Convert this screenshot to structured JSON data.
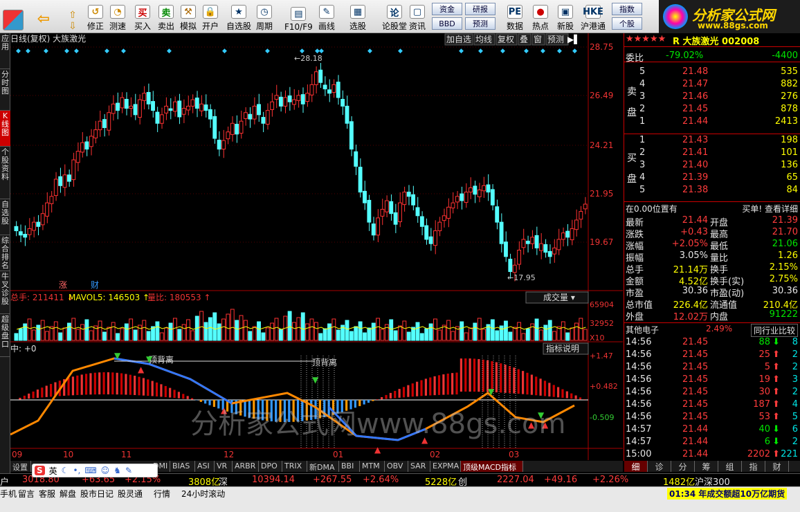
{
  "toolbar": {
    "items": [
      {
        "label": "买入",
        "icon": "买",
        "color": "#c00"
      },
      {
        "label": "卖出",
        "icon": "卖",
        "color": "#080"
      },
      {
        "label": "模拟",
        "icon": "⚒",
        "color": "#a60"
      },
      {
        "label": "开户",
        "icon": "🔒",
        "color": "#333"
      },
      {
        "label": "自选股",
        "icon": "★",
        "color": "#036"
      },
      {
        "label": "周期",
        "icon": "◷",
        "color": "#036"
      },
      {
        "label": "F10/F9",
        "icon": "▤",
        "color": "#036"
      },
      {
        "label": "画线",
        "icon": "✎",
        "color": "#036"
      },
      {
        "label": "选股",
        "icon": "▦",
        "color": "#036"
      },
      {
        "label": "论股堂",
        "icon": "论",
        "color": "#036"
      },
      {
        "label": "资讯",
        "icon": "▢",
        "color": "#036"
      },
      {
        "label": "数据",
        "icon": "PE",
        "color": "#036"
      },
      {
        "label": "热点",
        "icon": "●",
        "color": "#c00"
      },
      {
        "label": "新股",
        "icon": "▣",
        "color": "#036"
      },
      {
        "label": "沪港通",
        "icon": "HKE",
        "color": "#036"
      }
    ],
    "nav": [
      {
        "label": "修正",
        "icon": "↺"
      },
      {
        "label": "测速",
        "icon": "◔"
      }
    ],
    "buttons": [
      "资金",
      "BBD",
      "研报",
      "预测",
      "指数",
      "个股"
    ],
    "logo_text": "分析家公式网",
    "logo_url": "www.88gs.com"
  },
  "leftbar": [
    "应用",
    "分时图",
    "K线图",
    "个股资料",
    "自选股",
    "综合排名",
    "牛叉诊股",
    "超级盘口"
  ],
  "chart": {
    "title": "日线(复权)  大族激光",
    "toolbar": [
      "加自选",
      "均线",
      "复权",
      "叠",
      "窗",
      "预测"
    ],
    "price_ticks": [
      "28.75",
      "26.49",
      "24.21",
      "21.95",
      "19.67"
    ],
    "high_label": "28.18",
    "low_label": "17.95",
    "markers": [
      "涨",
      "财"
    ],
    "vol_legend": {
      "total": "总手: 211411",
      "mavol": "MAVOL5: 146503",
      "ratio": "量比: 180553",
      "dropdown": "成交量"
    },
    "vol_ticks": [
      "65904",
      "32952",
      "X10"
    ],
    "macd_legend": "中: +0",
    "macd_btn": "指标说明",
    "macd_ticks": [
      "+1.47",
      "+0.482",
      "-0.509"
    ],
    "macd_labels": [
      "顶背离",
      "顶背离"
    ],
    "x_labels": [
      "09",
      "10",
      "11",
      "12",
      "01",
      "02",
      "03"
    ],
    "watermark": "分析家公式网www.88gs.com"
  },
  "bottom_tabs": [
    "设置",
    "DMI",
    "BIAS",
    "ASI",
    "VR",
    "ARBR",
    "DPO",
    "TRIX",
    "新DMA",
    "BBI",
    "MTM",
    "OBV",
    "SAR",
    "EXPMA",
    "顶级MACD指标"
  ],
  "right": {
    "stock": "R 大族激光 002008",
    "weibi": {
      "label": "委比",
      "pct": "-79.02%",
      "diff": "-4400"
    },
    "sell": [
      {
        "n": "5",
        "p": "21.48",
        "v": "535"
      },
      {
        "n": "4",
        "p": "21.47",
        "v": "882"
      },
      {
        "n": "3",
        "p": "21.46",
        "v": "276"
      },
      {
        "n": "2",
        "p": "21.45",
        "v": "878"
      },
      {
        "n": "1",
        "p": "21.44",
        "v": "2413"
      }
    ],
    "buy": [
      {
        "n": "1",
        "p": "21.43",
        "v": "198"
      },
      {
        "n": "2",
        "p": "21.41",
        "v": "101"
      },
      {
        "n": "3",
        "p": "21.40",
        "v": "136"
      },
      {
        "n": "4",
        "p": "21.39",
        "v": "65"
      },
      {
        "n": "5",
        "p": "21.38",
        "v": "84"
      }
    ],
    "sell_label": "卖盘",
    "buy_label": "买盘",
    "pos": "在0.00位置有",
    "pos_right": "买单! 查看详细",
    "quotes": [
      [
        "最新",
        "21.44",
        "开盘",
        "21.39"
      ],
      [
        "涨跌",
        "+0.43",
        "最高",
        "21.70"
      ],
      [
        "涨幅",
        "+2.05%",
        "最低",
        "21.06"
      ],
      [
        "振幅",
        "3.05%",
        "量比",
        "1.26"
      ],
      [
        "总手",
        "21.14万",
        "换手",
        "2.15%"
      ],
      [
        "金额",
        "4.52亿",
        "换手(实)",
        "2.75%"
      ],
      [
        "市盈",
        "30.36",
        "市盈(动)",
        "30.36"
      ],
      [
        "总市值",
        "226.4亿",
        "流通值",
        "210.4亿"
      ],
      [
        "外盘",
        "12.02万",
        "内盘",
        "91222"
      ]
    ],
    "sector": "其他电子",
    "sector_pct": "2.49%",
    "sector_btn": "同行业比较",
    "ticks": [
      [
        "14:56",
        "21.45",
        "88",
        "8"
      ],
      [
        "14:56",
        "21.45",
        "25",
        "2"
      ],
      [
        "14:56",
        "21.45",
        "5",
        "2"
      ],
      [
        "14:56",
        "21.45",
        "19",
        "3"
      ],
      [
        "14:56",
        "21.45",
        "30",
        "2"
      ],
      [
        "14:56",
        "21.45",
        "187",
        "4"
      ],
      [
        "14:56",
        "21.45",
        "53",
        "5"
      ],
      [
        "14:57",
        "21.44",
        "40",
        "6"
      ],
      [
        "14:57",
        "21.44",
        "6",
        "2"
      ],
      [
        "15:00",
        "21.44",
        "2202",
        "221"
      ]
    ],
    "tabs": [
      "细",
      "诊",
      "分",
      "筹",
      "组",
      "指",
      "财"
    ]
  },
  "status": {
    "a": "3018.80",
    "b": "+63.65",
    "c": "+2.15%",
    "d": "3808亿",
    "e": "深",
    "f": "10394.14",
    "g": "+267.55",
    "h": "+2.64%",
    "i": "5228亿",
    "j": "创",
    "k": "2227.04",
    "l": "+49.16",
    "m": "+2.26%",
    "n": "1482亿",
    "o": "沪深300"
  },
  "status2": [
    "手机",
    "留言",
    "客服",
    "解盘",
    "股市日记",
    "股灵通",
    "行情",
    "24小时滚动"
  ],
  "ticker": "01:34 年成交额超10万亿期货"
}
